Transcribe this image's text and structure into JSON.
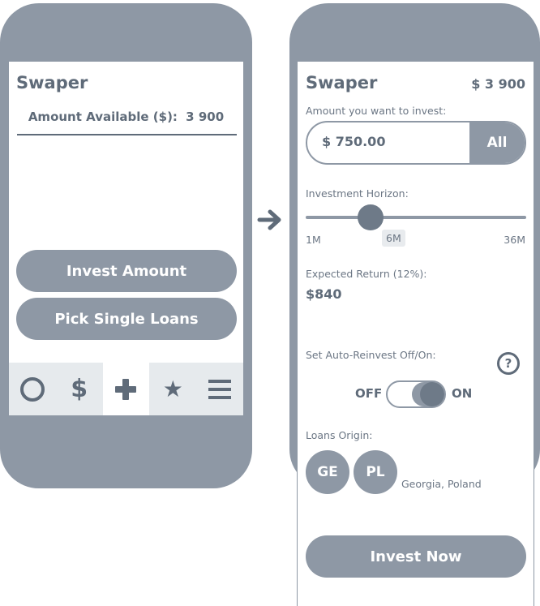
{
  "left": {
    "title": "Swaper",
    "amount_label": "Amount Available ($):",
    "amount_value": "3 900",
    "invest_amount_button": "Invest Amount",
    "pick_loans_button": "Pick Single Loans",
    "tabs": [
      {
        "icon": "circle-icon"
      },
      {
        "icon": "dollar-icon",
        "glyph": "$"
      },
      {
        "icon": "plus-icon"
      },
      {
        "icon": "star-icon",
        "glyph": "★"
      },
      {
        "icon": "menu-icon"
      }
    ]
  },
  "right": {
    "title": "Swaper",
    "balance": "$ 3 900",
    "amount_label": "Amount you want to invest:",
    "amount_value": "$ 750.00",
    "all_button": "All",
    "horizon_label": "Investment Horizon:",
    "horizon_min": "1M",
    "horizon_selected": "6M",
    "horizon_max": "36M",
    "return_label": "Expected Return (12%):",
    "return_value": "$840",
    "auto_reinvest_label": "Set Auto-Reinvest Off/On:",
    "help_glyph": "?",
    "toggle_off": "OFF",
    "toggle_on": "ON",
    "toggle_state": "on",
    "origin_label": "Loans Origin:",
    "origins": [
      "GE",
      "PL"
    ],
    "origin_text": "Georgia, Poland",
    "invest_now_button": "Invest Now"
  },
  "colors": {
    "phone": "#8e98a5",
    "text": "#5f6b79",
    "tabbar": "#e6eaed"
  }
}
